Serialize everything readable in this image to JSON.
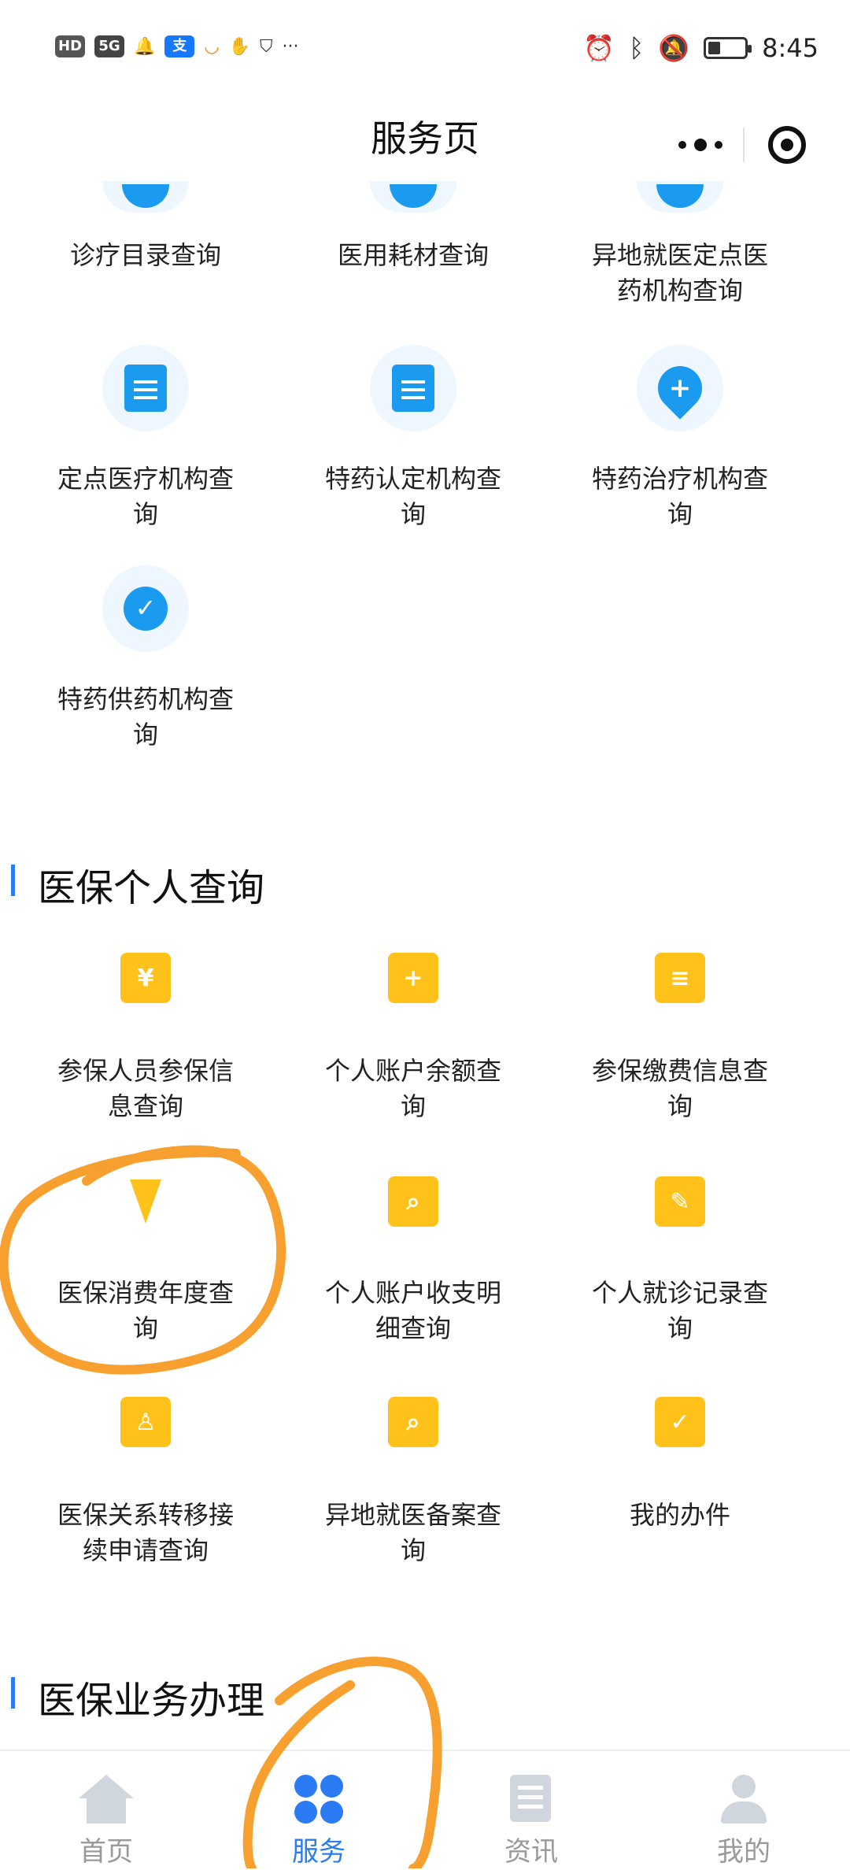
{
  "status_bar": {
    "badges": [
      "HD",
      "5G",
      "支"
    ],
    "time": "8:45",
    "battery_level": 0.35
  },
  "nav": {
    "title": "服务页"
  },
  "top_section": {
    "items": [
      {
        "label": "诊疗目录查询",
        "icon": "blue-partial-icon"
      },
      {
        "label": "医用耗材查询",
        "icon": "blue-partial-icon"
      },
      {
        "label": "异地就医定点医药机构查询",
        "icon": "blue-partial-icon"
      },
      {
        "label": "定点医疗机构查询",
        "icon": "document-icon"
      },
      {
        "label": "特药认定机构查询",
        "icon": "location-document-icon"
      },
      {
        "label": "特药治疗机构查询",
        "icon": "medical-pin-icon"
      },
      {
        "label": "特药供药机构查询",
        "icon": "check-location-icon"
      }
    ]
  },
  "personal_query": {
    "title": "医保个人查询",
    "items": [
      {
        "label": "参保人员参保信息查询",
        "icon": "wallet-icon",
        "glyph": "¥"
      },
      {
        "label": "个人账户余额查询",
        "icon": "medical-kit-icon",
        "glyph": "+"
      },
      {
        "label": "参保缴费信息查询",
        "icon": "person-document-icon",
        "glyph": "≡"
      },
      {
        "label": "医保消费年度查询",
        "icon": "tie-icon",
        "glyph": ""
      },
      {
        "label": "个人账户收支明细查询",
        "icon": "search-document-icon",
        "glyph": "⌕"
      },
      {
        "label": "个人就诊记录查询",
        "icon": "edit-document-icon",
        "glyph": "✎"
      },
      {
        "label": "医保关系转移接续申请查询",
        "icon": "badge-icon",
        "glyph": "♙"
      },
      {
        "label": "异地就医备案查询",
        "icon": "search-document-icon",
        "glyph": "⌕"
      },
      {
        "label": "我的办件",
        "icon": "stamp-icon",
        "glyph": "✓"
      }
    ]
  },
  "business": {
    "title": "医保业务办理"
  },
  "tabbar": {
    "tabs": [
      {
        "label": "首页",
        "icon": "home-icon",
        "active": false
      },
      {
        "label": "服务",
        "icon": "clover-icon",
        "active": true
      },
      {
        "label": "资讯",
        "icon": "news-icon",
        "active": false
      },
      {
        "label": "我的",
        "icon": "person-icon",
        "active": false
      }
    ]
  },
  "colors": {
    "accent_blue": "#2b7bf5",
    "icon_blue": "#1a9bf0",
    "icon_yellow": "#ffc21a",
    "annotation_orange": "#f7a030"
  }
}
